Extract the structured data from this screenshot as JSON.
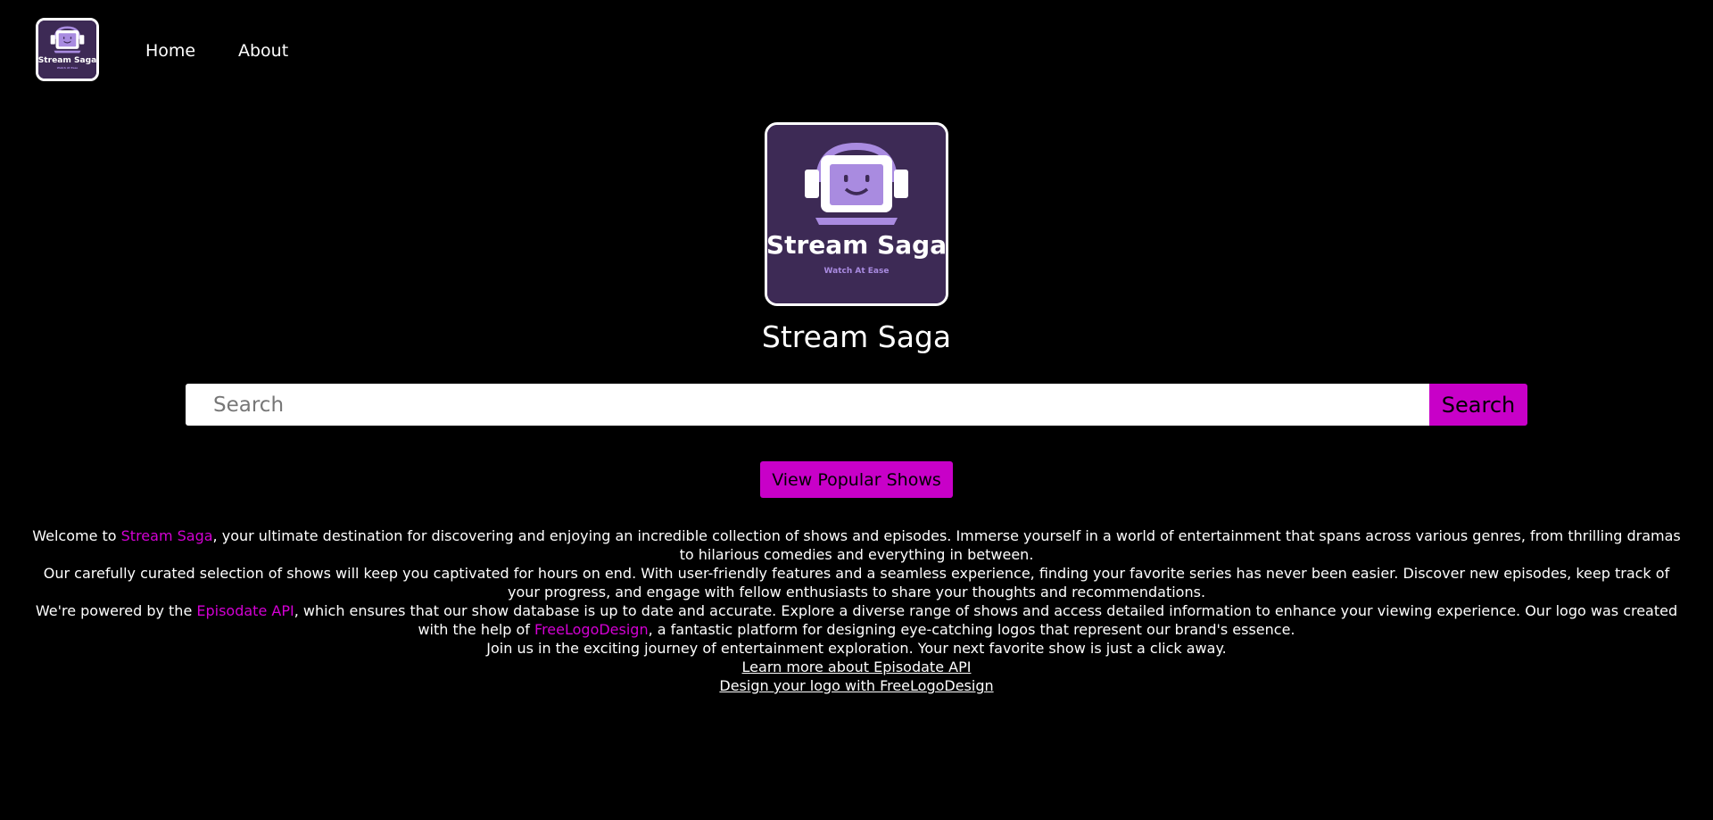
{
  "nav": {
    "logo_name": "Stream Saga",
    "logo_tagline": "Watch At Ease",
    "home_label": "Home",
    "about_label": "About"
  },
  "hero": {
    "logo_name": "Stream Saga",
    "logo_tagline": "Watch At Ease",
    "title": "Stream Saga"
  },
  "search": {
    "placeholder": "Search",
    "value": "",
    "button_label": "Search"
  },
  "popular_button_label": "View Popular Shows",
  "about": {
    "p1_prefix": "Welcome to ",
    "p1_link": "Stream Saga",
    "p1_suffix": ", your ultimate destination for discovering and enjoying an incredible collection of shows and episodes. Immerse yourself in a world of entertainment that spans across various genres, from thrilling dramas to hilarious comedies and everything in between.",
    "p2": "Our carefully curated selection of shows will keep you captivated for hours on end. With user-friendly features and a seamless experience, finding your favorite series has never been easier. Discover new episodes, keep track of your progress, and engage with fellow enthusiasts to share your thoughts and recommendations.",
    "p3_prefix": "We're powered by the ",
    "p3_link1": "Episodate API",
    "p3_middle": ", which ensures that our show database is up to date and accurate. Explore a diverse range of shows and access detailed information to enhance your viewing experience. Our logo was created with the help of ",
    "p3_link2": "FreeLogoDesign",
    "p3_suffix": ", a fantastic platform for designing eye-catching logos that represent our brand's essence.",
    "p4": "Join us in the exciting journey of entertainment exploration. Your next favorite show is just a click away.",
    "link_episodate": "Learn more about Episodate API",
    "link_freelogo": "Design your logo with FreeLogoDesign"
  },
  "colors": {
    "background": "#000000",
    "accent": "#c800c8",
    "logo_bg": "#3d2a55",
    "logo_purple": "#a98be0"
  }
}
